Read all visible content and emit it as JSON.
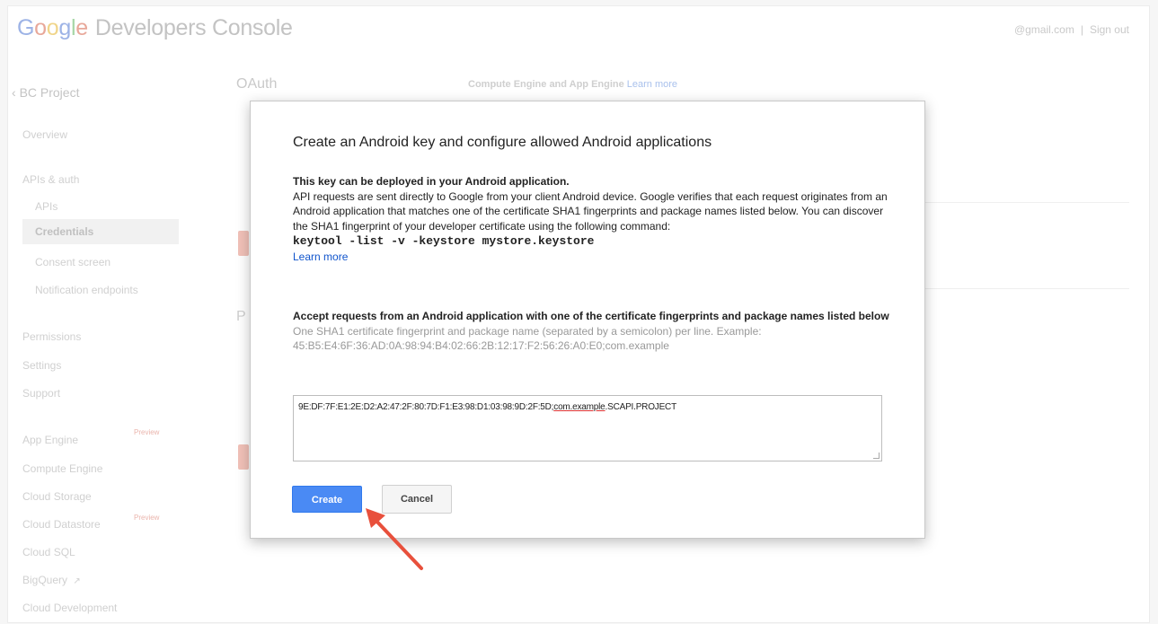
{
  "header": {
    "logo": {
      "g1": "G",
      "g2": "o",
      "g3": "o",
      "g4": "g",
      "g5": "l",
      "g6": "e"
    },
    "product": "Developers Console",
    "account": "@gmail.com",
    "separator": "|",
    "sign_out": "Sign out"
  },
  "sidebar": {
    "back_label": "BC Project",
    "overview": "Overview",
    "apis_auth": "APIs & auth",
    "apis": "APIs",
    "credentials": "Credentials",
    "consent_screen": "Consent screen",
    "notification_endpoints": "Notification endpoints",
    "permissions": "Permissions",
    "settings": "Settings",
    "support": "Support",
    "app_engine": "App Engine",
    "app_engine_badge": "Preview",
    "compute_engine": "Compute Engine",
    "cloud_storage": "Cloud Storage",
    "cloud_datastore": "Cloud Datastore",
    "cloud_datastore_badge": "Preview",
    "cloud_sql": "Cloud SQL",
    "bigquery": "BigQuery",
    "cloud_development": "Cloud Development"
  },
  "main": {
    "oauth_title": "OAuth",
    "compute_note": "Compute Engine and App Engine",
    "compute_note_link": "Learn more",
    "public_title": "P"
  },
  "dialog": {
    "title": "Create an Android key and configure allowed Android applications",
    "deploy_heading": "This key can be deployed in your Android application.",
    "deploy_body": "API requests are sent directly to Google from your client Android device. Google verifies that each request originates from an Android application that matches one of the certificate SHA1 fingerprints and package names listed below. You can discover the SHA1 fingerprint of your developer certificate using the following command:",
    "command": "keytool -list -v -keystore mystore.keystore",
    "learn_more": "Learn more",
    "accept_heading": "Accept requests from an Android application with one of the certificate fingerprints and package names listed below",
    "accept_hint": "One SHA1 certificate fingerprint and package name (separated by a semicolon) per line. Example: 45:B5:E4:6F:36:AD:0A:98:94:B4:02:66:2B:12:17:F2:56:26:A0:E0;com.example",
    "textarea_prefix": "9E:DF:7F:E1:2E:D2:A2:47:2F:80:7D:F1:E3:98:D1:03:98:9D:2F:5D;",
    "textarea_package": "com.example",
    "textarea_suffix": ".SCAPI.PROJECT",
    "create_label": "Create",
    "cancel_label": "Cancel"
  },
  "colors": {
    "primary_button": "#4a8af4",
    "annotation_arrow": "#e8503c",
    "link": "#1155cc"
  }
}
